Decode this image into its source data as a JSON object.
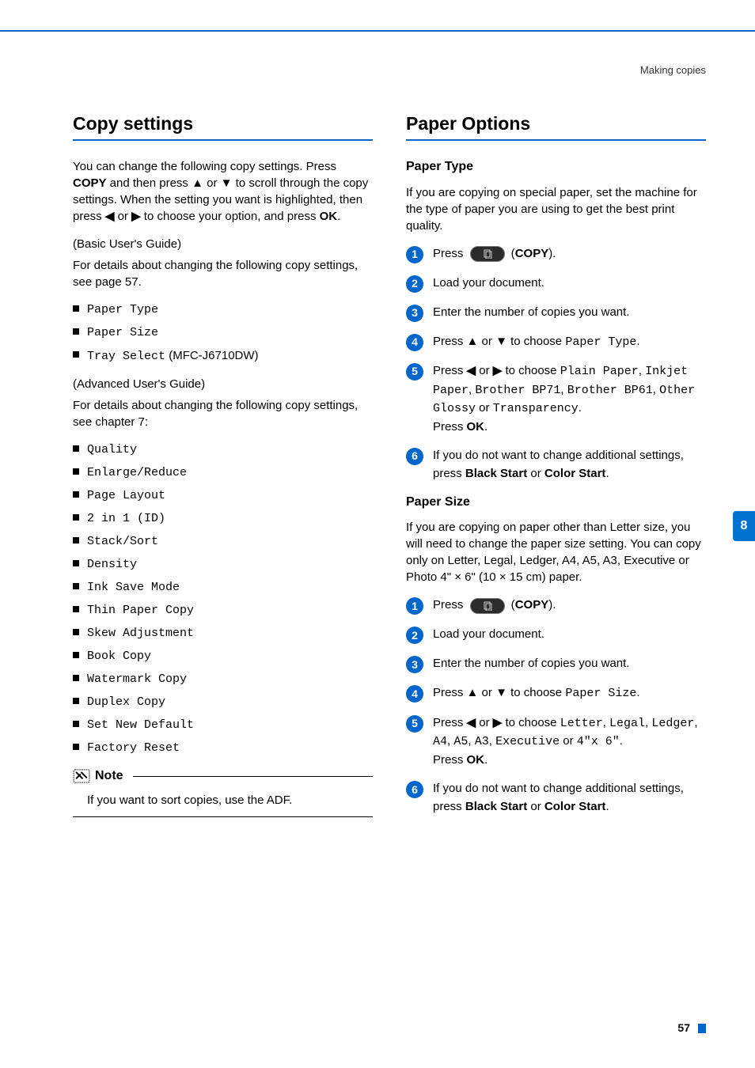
{
  "header": {
    "section": "Making copies"
  },
  "side_tab": "8",
  "page_number": "57",
  "left": {
    "title": "Copy settings",
    "intro_parts": {
      "p1a": "You can change the following copy settings. Press ",
      "p1b": "COPY",
      "p1c": " and then press ",
      "p1d": " or ",
      "p1e": " to scroll through the copy settings. When the setting you want is highlighted, then press ",
      "p1f": " or ",
      "p1g": " to choose your option, and press ",
      "p1h": "OK",
      "p1i": "."
    },
    "basic_label": "(Basic User's Guide)",
    "basic_detail": "For details about changing the following copy settings, see page 57.",
    "basic_items": [
      "Paper Type",
      "Paper Size"
    ],
    "tray_item": "Tray Select",
    "tray_suffix": " (MFC-J6710DW)",
    "adv_label": "(Advanced User's Guide)",
    "adv_detail": "For details about changing the following copy settings, see chapter 7:",
    "adv_items": [
      "Quality",
      "Enlarge/Reduce",
      "Page Layout",
      "2 in 1 (ID)",
      "Stack/Sort",
      "Density",
      "Ink Save Mode",
      "Thin Paper Copy",
      "Skew Adjustment",
      "Book Copy",
      "Watermark Copy",
      "Duplex Copy",
      "Set New Default",
      "Factory Reset"
    ],
    "note_title": "Note",
    "note_body": "If you want to sort copies, use the ADF."
  },
  "right": {
    "title": "Paper Options",
    "paper_type": {
      "heading": "Paper Type",
      "intro": "If you are copying on special paper, set the machine for the type of paper you are using to get the best print quality.",
      "steps": {
        "s1a": "Press ",
        "s1b": " (",
        "s1c": "COPY",
        "s1d": ").",
        "s2": "Load your document.",
        "s3": "Enter the number of copies you want.",
        "s4a": "Press ",
        "s4b": " or ",
        "s4c": " to choose ",
        "s4d": "Paper Type",
        "s4e": ".",
        "s5a": "Press ",
        "s5b": " or ",
        "s5c": " to choose ",
        "s5d": "Plain Paper",
        "s5e": ", ",
        "s5f": "Inkjet Paper",
        "s5g": ", ",
        "s5h": "Brother BP71",
        "s5i": ", ",
        "s5j": "Brother BP61",
        "s5k": ", ",
        "s5l": "Other Glossy",
        "s5m": " or ",
        "s5n": "Transparency",
        "s5o": ".",
        "s5p": "Press ",
        "s5q": "OK",
        "s5r": ".",
        "s6a": "If you do not want to change additional settings, press ",
        "s6b": "Black Start",
        "s6c": " or ",
        "s6d": "Color Start",
        "s6e": "."
      }
    },
    "paper_size": {
      "heading": "Paper Size",
      "intro_a": "If you are copying on paper other than Letter size, you will need to change the paper size setting. You can copy only on Letter, Legal, Ledger, A4, A5, A3, Executive or Photo 4\" ",
      "intro_b": " 6\" (10 ",
      "intro_c": " 15 cm) paper.",
      "steps": {
        "s1a": "Press ",
        "s1b": " (",
        "s1c": "COPY",
        "s1d": ").",
        "s2": "Load your document.",
        "s3": "Enter the number of copies you want.",
        "s4a": "Press ",
        "s4b": " or ",
        "s4c": " to choose ",
        "s4d": "Paper Size",
        "s4e": ".",
        "s5a": "Press ",
        "s5b": " or ",
        "s5c": " to choose ",
        "s5d": "Letter",
        "s5e": ", ",
        "s5f": "Legal",
        "s5g": ", ",
        "s5h": "Ledger",
        "s5i": ", ",
        "s5j": "A4",
        "s5k": ", ",
        "s5l": "A5",
        "s5m": ", ",
        "s5n": "A3",
        "s5o": ", ",
        "s5p": "Executive",
        "s5q": " or ",
        "s5r": "4\"x 6\"",
        "s5s": ".",
        "s5t": "Press ",
        "s5u": "OK",
        "s5v": ".",
        "s6a": "If you do not want to change additional settings, press ",
        "s6b": "Black Start",
        "s6c": " or ",
        "s6d": "Color Start",
        "s6e": "."
      }
    }
  }
}
